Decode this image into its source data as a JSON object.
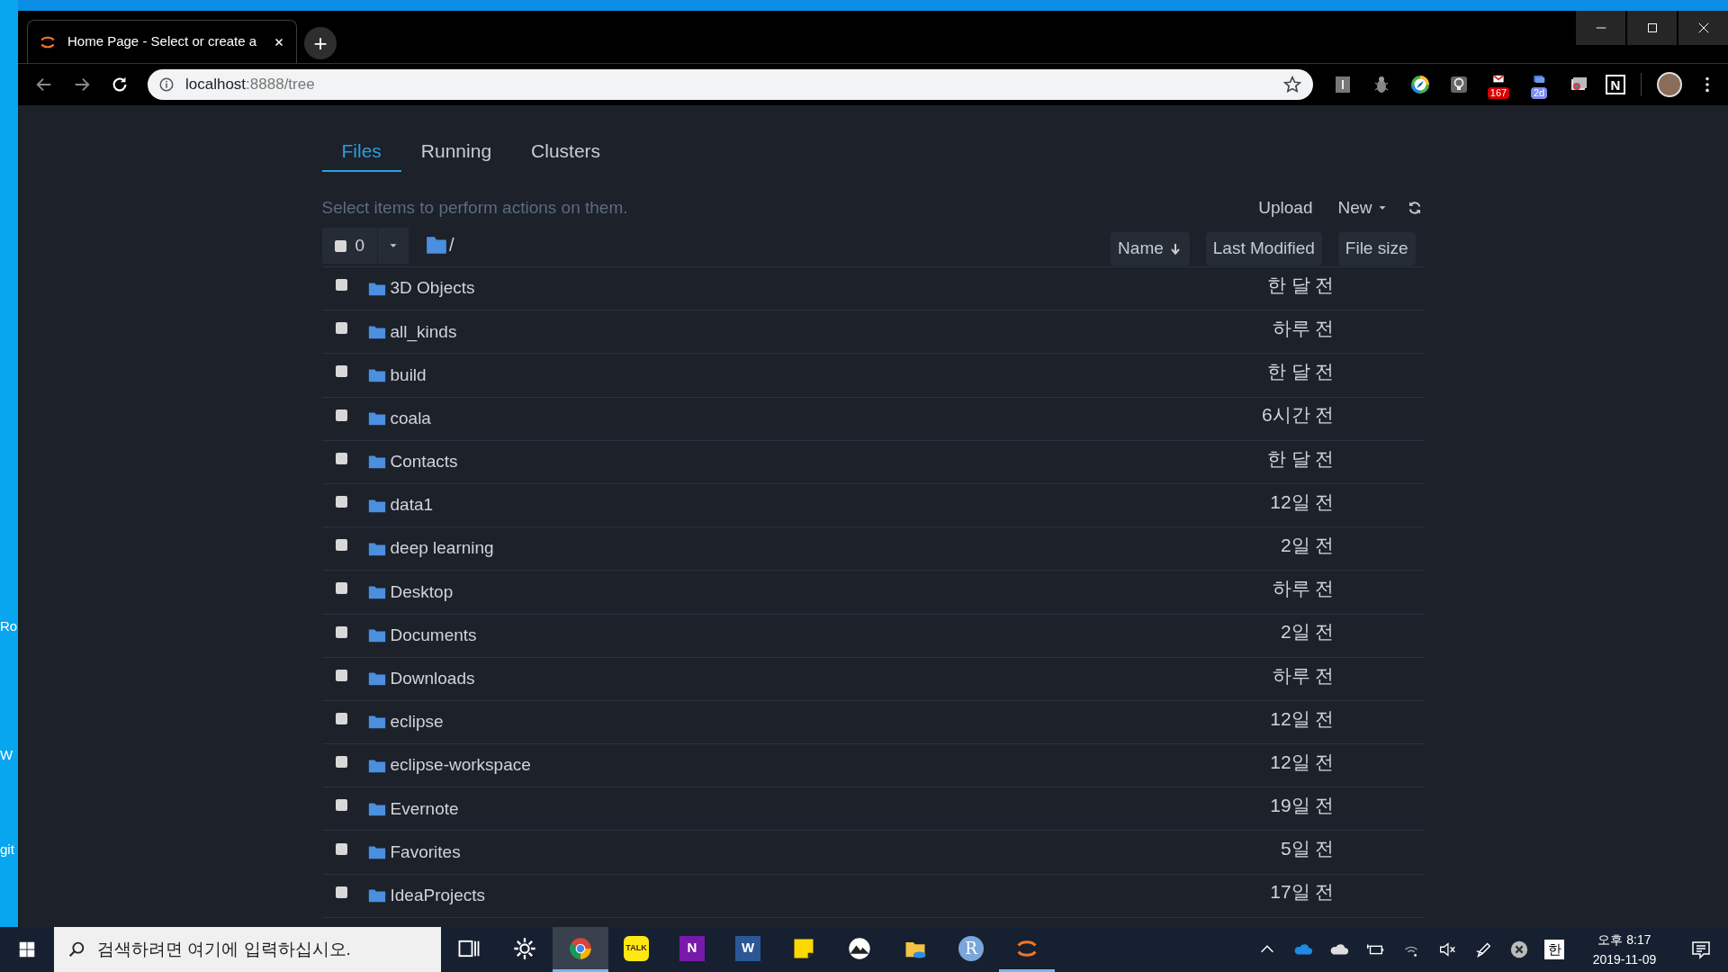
{
  "desktop": {
    "icon_labels": [
      "Ro",
      "W",
      "git"
    ]
  },
  "browser": {
    "tab": {
      "title": "Home Page - Select or create a",
      "selected": true
    },
    "new_tab": "+",
    "address": {
      "host": "localhost",
      "path": ":8888/tree"
    },
    "extensions": [
      {
        "kind": "box"
      },
      {
        "kind": "bug"
      },
      {
        "kind": "compass"
      },
      {
        "kind": "bulb"
      },
      {
        "kind": "mail",
        "badge": "167"
      },
      {
        "kind": "tabs",
        "badge": "2d"
      },
      {
        "kind": "windows"
      },
      {
        "kind": "letter",
        "label": "N"
      },
      {
        "kind": "avatar"
      }
    ]
  },
  "jupyter": {
    "tabs": [
      {
        "label": "Files",
        "selected": true
      },
      {
        "label": "Running",
        "selected": false
      },
      {
        "label": "Clusters",
        "selected": false
      }
    ],
    "hint": "Select items to perform actions on them.",
    "upload": "Upload",
    "new": "New",
    "all_checked": false,
    "selected_count": "0",
    "breadcrumb": "/",
    "sort_buttons": [
      {
        "label": "Name",
        "sorted": true
      },
      {
        "label": "Last Modified",
        "sorted": false
      },
      {
        "label": "File size",
        "sorted": false
      }
    ],
    "files": [
      {
        "name": "3D Objects",
        "modified": "한 달 전",
        "checked": false
      },
      {
        "name": "all_kinds",
        "modified": "하루 전",
        "checked": false
      },
      {
        "name": "build",
        "modified": "한 달 전",
        "checked": false
      },
      {
        "name": "coala",
        "modified": "6시간 전",
        "checked": false
      },
      {
        "name": "Contacts",
        "modified": "한 달 전",
        "checked": false
      },
      {
        "name": "data1",
        "modified": "12일 전",
        "checked": false
      },
      {
        "name": "deep learning",
        "modified": "2일 전",
        "checked": false
      },
      {
        "name": "Desktop",
        "modified": "하루 전",
        "checked": false
      },
      {
        "name": "Documents",
        "modified": "2일 전",
        "checked": false
      },
      {
        "name": "Downloads",
        "modified": "하루 전",
        "checked": false
      },
      {
        "name": "eclipse",
        "modified": "12일 전",
        "checked": false
      },
      {
        "name": "eclipse-workspace",
        "modified": "12일 전",
        "checked": false
      },
      {
        "name": "Evernote",
        "modified": "19일 전",
        "checked": false
      },
      {
        "name": "Favorites",
        "modified": "5일 전",
        "checked": false
      },
      {
        "name": "IdeaProjects",
        "modified": "17일 전",
        "checked": false
      }
    ]
  },
  "taskbar": {
    "search_placeholder": "검색하려면 여기에 입력하십시오.",
    "apps": [
      {
        "kind": "taskview",
        "focused": false,
        "running": false
      },
      {
        "kind": "gear",
        "focused": false,
        "running": false
      },
      {
        "kind": "chrome",
        "focused": true,
        "running": true
      },
      {
        "kind": "talk",
        "label": "TALK",
        "focused": false,
        "running": false
      },
      {
        "kind": "note",
        "label": "N",
        "focused": false,
        "running": false
      },
      {
        "kind": "doc",
        "label": "W",
        "focused": false,
        "running": false
      },
      {
        "kind": "sticky",
        "focused": false,
        "running": false
      },
      {
        "kind": "mountain",
        "focused": false,
        "running": false
      },
      {
        "kind": "explorer",
        "focused": false,
        "running": false
      },
      {
        "kind": "circle",
        "label": "R",
        "focused": false,
        "running": false
      },
      {
        "kind": "jupyter",
        "focused": false,
        "running": true
      }
    ],
    "tray": [
      {
        "kind": "chevron"
      },
      {
        "kind": "cloud-blue"
      },
      {
        "kind": "cloud-white"
      },
      {
        "kind": "battery"
      },
      {
        "kind": "wifi"
      },
      {
        "kind": "mute"
      },
      {
        "kind": "pen"
      },
      {
        "kind": "x-circle"
      }
    ],
    "ime": "한",
    "clock": {
      "time": "오후 8:17",
      "date": "2019-11-09"
    }
  }
}
